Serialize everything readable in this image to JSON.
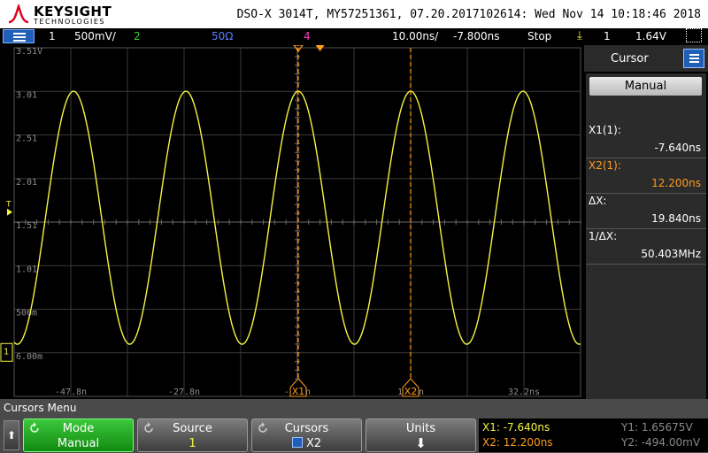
{
  "header": {
    "brand": "KEYSIGHT",
    "brand_sub": "TECHNOLOGIES",
    "title": "DSO-X 3014T, MY57251361, 07.20.2017102614: Wed Nov 14 10:18:46 2018"
  },
  "status_bar": {
    "ch1_num": "1",
    "ch1_scale": "500mV/",
    "ch2_num": "2",
    "impedance": "50Ω",
    "ch4_num": "4",
    "timebase": "10.00ns/",
    "delay": "-7.800ns",
    "run_state": "Stop",
    "trigger_source": "1",
    "trigger_level": "1.64V",
    "colors": {
      "ch1": "#f5f542",
      "ch2": "#37d637",
      "impedance": "#5a7dff",
      "ch4": "#ff3cc8",
      "trigger_icon": "#f5f542"
    }
  },
  "display": {
    "y_labels": [
      "3.51V",
      "3.01",
      "2.51",
      "2.01",
      "1.51",
      "1.01",
      "506m",
      "6.00m"
    ],
    "x_labels": [
      "-47.8n",
      "-27.8n",
      "-7.8n",
      "12.2n",
      "32.2ns"
    ],
    "cursor_x1_label": "X1",
    "cursor_x2_label": "X2",
    "trigger_marker": "T",
    "ground_marker": "1"
  },
  "chart_data": {
    "type": "line",
    "title": "",
    "xlabel": "",
    "ylabel": "",
    "x_unit": "ns",
    "y_unit": "V",
    "xlim": [
      -57.8,
      42.2
    ],
    "ylim": [
      -0.5,
      3.51
    ],
    "series": [
      {
        "period_ns": 19.84,
        "v_max": 3.01,
        "v_min": 0.1,
        "peak_x_ns": -7.64
      }
    ],
    "cursors": {
      "x1": -7.64,
      "x2": 12.2
    }
  },
  "right_panel": {
    "title": "Cursor",
    "mode": "Manual",
    "x1_label": "X1(1):",
    "x1_value": "-7.640ns",
    "x2_label": "X2(1):",
    "x2_value": "12.200ns",
    "dx_label": "ΔX:",
    "dx_value": "19.840ns",
    "inv_dx_label": "1/ΔX:",
    "inv_dx_value": "50.403MHz"
  },
  "softkeys": {
    "menu_title": "Cursors Menu",
    "mode_label": "Mode",
    "mode_value": "Manual",
    "source_label": "Source",
    "source_value": "1",
    "cursors_label": "Cursors",
    "cursors_value": "X2",
    "units_label": "Units",
    "readout": {
      "x1": "X1: -7.640ns",
      "x2": "X2: 12.200ns",
      "y1": "Y1: 1.65675V",
      "y2": "Y2: -494.00mV"
    }
  }
}
